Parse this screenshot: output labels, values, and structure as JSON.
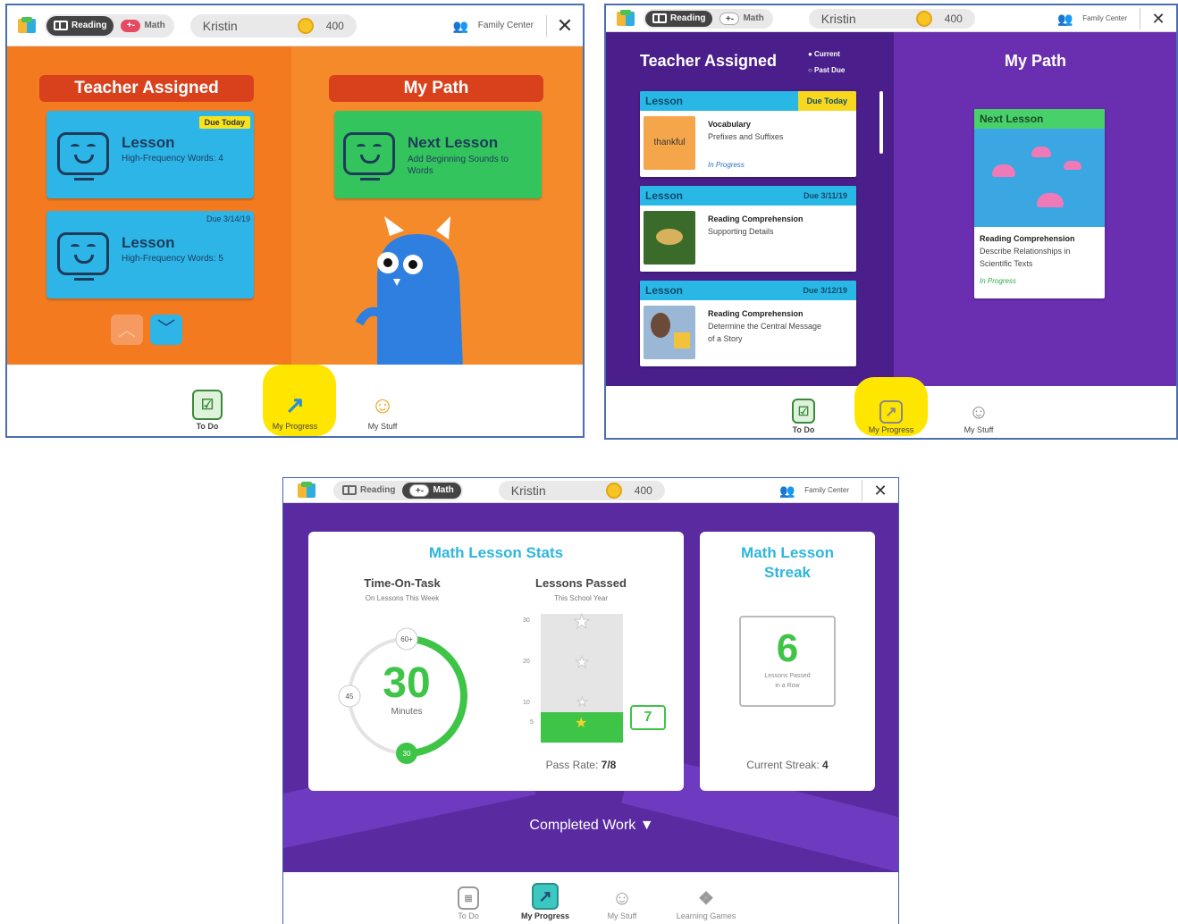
{
  "topbar": {
    "reading_label": "Reading",
    "math_label": "Math",
    "user_name": "Kristin",
    "coins": "400",
    "family_label": "Family Center",
    "close_symbol": "✕"
  },
  "bottom_nav": {
    "todo": "To Do",
    "progress": "My Progress",
    "stuff": "My Stuff",
    "games": "Learning Games"
  },
  "panel1": {
    "teacher_header": "Teacher Assigned",
    "path_header": "My Path",
    "card1": {
      "title": "Lesson",
      "subtitle": "High-Frequency Words: 4",
      "badge": "Due Today"
    },
    "card2": {
      "title": "Lesson",
      "subtitle": "High-Frequency Words: 5",
      "badge": "Due 3/14/19"
    },
    "next": {
      "title": "Next Lesson",
      "subtitle": "Add Beginning Sounds to Words"
    }
  },
  "panel2": {
    "teacher_header": "Teacher Assigned",
    "filter_current": "● Current",
    "filter_past": "○ Past Due",
    "path_header": "My Path",
    "lessons": [
      {
        "header": "Lesson",
        "due": "Due Today",
        "thumb_text": "thankful",
        "line1": "Vocabulary",
        "line2": "Prefixes and Suffixes",
        "status": "In Progress"
      },
      {
        "header": "Lesson",
        "due": "Due 3/11/19",
        "line1": "Reading Comprehension",
        "line2": "Supporting Details"
      },
      {
        "header": "Lesson",
        "due": "Due 3/12/19",
        "line1": "Reading Comprehension",
        "line2": "Determine the Central Message",
        "line3": "of a Story"
      }
    ],
    "next": {
      "header": "Next Lesson",
      "line1": "Reading Comprehension",
      "line2": "Describe Relationships in",
      "line3": "Scientific Texts",
      "status": "In Progress"
    }
  },
  "panel3": {
    "stats_title": "Math Lesson Stats",
    "time_title": "Time-On-Task",
    "time_sub": "On Lessons This Week",
    "time_value": "30",
    "time_unit": "Minutes",
    "ring_60": "60+",
    "ring_45": "45",
    "ring_30": "30",
    "ring_progress": 0.5,
    "passed_title": "Lessons Passed",
    "passed_sub": "This School Year",
    "bar_ticks": [
      "30",
      "20",
      "10",
      "5"
    ],
    "passed_value": "7",
    "pass_rate_label": "Pass Rate:",
    "pass_rate_value": "7/8",
    "streak_title_1": "Math Lesson",
    "streak_title_2": "Streak",
    "streak_value": "6",
    "streak_sub_1": "Lessons Passed",
    "streak_sub_2": "in a Row",
    "current_streak_label": "Current Streak:",
    "current_streak_value": "4",
    "completed_work": "Completed Work"
  }
}
